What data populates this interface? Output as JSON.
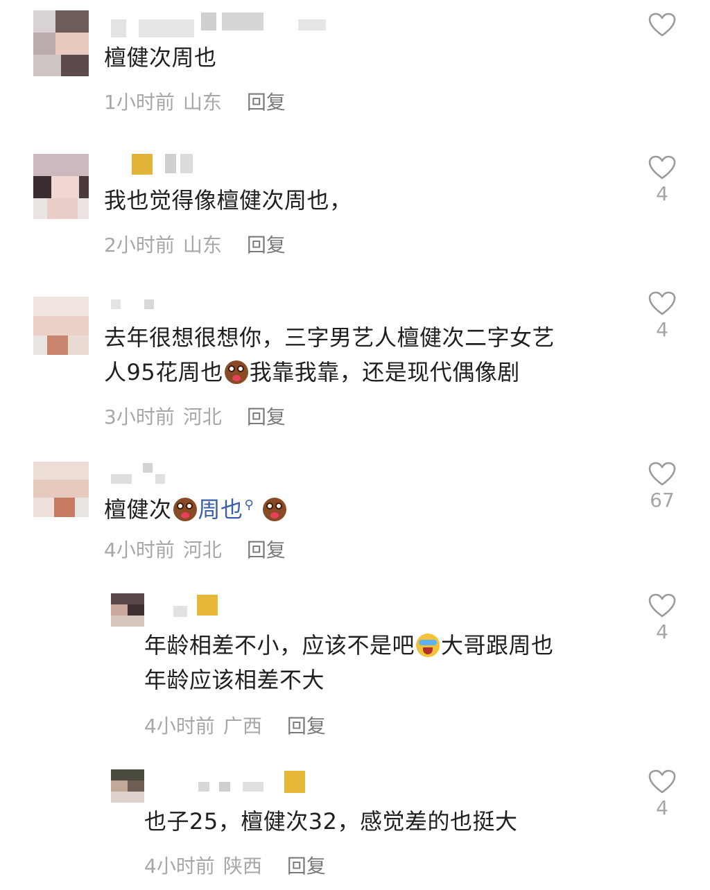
{
  "comments": [
    {
      "text_lines": [
        "檀健次周也"
      ],
      "time": "1小时前",
      "location": "山东",
      "reply_label": "回复",
      "like_count": ""
    },
    {
      "text_lines": [
        "我也觉得像檀健次周也，"
      ],
      "time": "2小时前",
      "location": "山东",
      "reply_label": "回复",
      "like_count": "4"
    },
    {
      "line1": "去年很想很想你，三字男艺人檀健次二字女艺",
      "line2_a": "人95花周也",
      "line2_b": "我靠我靠，还是现代偶像剧",
      "time": "3小时前",
      "location": "河北",
      "reply_label": "回复",
      "like_count": "4"
    },
    {
      "text_a": "檀健次",
      "mention": "周也",
      "time": "4小时前",
      "location": "河北",
      "reply_label": "回复",
      "like_count": "67"
    },
    {
      "line1_a": "年龄相差不小，应该不是吧",
      "line1_b": "大哥跟周也",
      "line2": "年龄应该相差不大",
      "time": "4小时前",
      "location": "广西",
      "reply_label": "回复",
      "like_count": "4"
    },
    {
      "text_lines": [
        "也子25，檀健次32，感觉差的也挺大"
      ],
      "time": "4小时前",
      "location": "陕西",
      "reply_label": "回复",
      "like_count": "4"
    }
  ],
  "icons": {
    "like": "heart-outline-icon",
    "emoji_wow": "wow-face-emoji-icon",
    "emoji_cry": "laugh-cry-emoji-icon",
    "search": "search-magnifier-icon"
  },
  "colors": {
    "text": "#1f1f1f",
    "meta": "#a7a7a7",
    "reply": "#7a7a7a",
    "mention": "#3a5fa8",
    "like_icon": "#9a9a9a"
  }
}
